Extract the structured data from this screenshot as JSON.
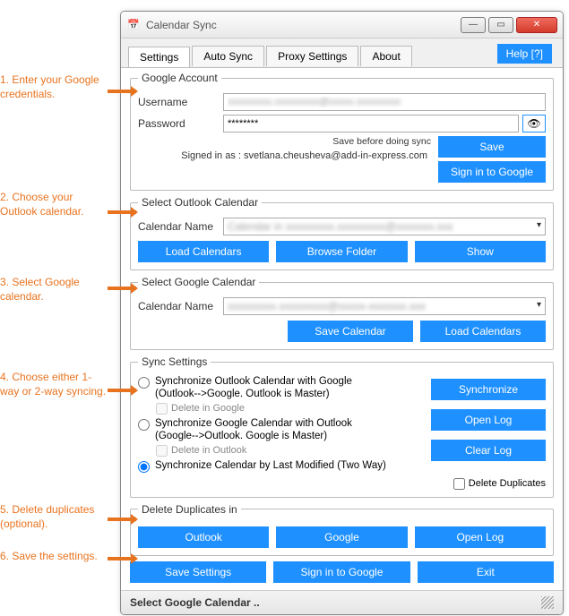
{
  "window": {
    "title": "Calendar Sync"
  },
  "tabs": {
    "settings": "Settings",
    "auto": "Auto Sync",
    "proxy": "Proxy Settings",
    "about": "About",
    "help": "Help [?]"
  },
  "annotations": {
    "a1": "1. Enter your Google credentials.",
    "a2": "2. Choose your Outlook calendar.",
    "a3": "3. Select Google calendar.",
    "a4": "4. Choose either 1-way or 2-way syncing.",
    "a5": "5. Delete duplicates (optional).",
    "a6": "6. Save the settings."
  },
  "google_account": {
    "legend": "Google Account",
    "username_label": "Username",
    "username_value": "xxxxxxxxx.xxxxxxxxx@xxxxx.xxxxxxxxx",
    "password_label": "Password",
    "password_value": "********",
    "save_note": "Save before doing sync",
    "signed_in_prefix": "Signed in as : ",
    "signed_in_email": "svetlana.cheusheva@add-in-express.com",
    "save_btn": "Save",
    "signin_btn": "Sign in to Google"
  },
  "outlook": {
    "legend": "Select Outlook Calendar",
    "name_label": "Calendar Name",
    "name_value": "Calendar in xxxxxxxxx.xxxxxxxxx@xxxxxxx.xxx",
    "load_btn": "Load Calendars",
    "browse_btn": "Browse Folder",
    "show_btn": "Show"
  },
  "gcal": {
    "legend": "Select Google Calendar",
    "name_label": "Calendar Name",
    "name_value": "xxxxxxxxx.xxxxxxxxx@xxxxx-xxxxxxx.xxx",
    "save_btn": "Save Calendar",
    "load_btn": "Load Calendars"
  },
  "sync": {
    "legend": "Sync Settings",
    "opt1a": "Synchronize Outlook Calendar with Google",
    "opt1b": "(Outlook-->Google. Outlook is Master)",
    "del1": "Delete in Google",
    "opt2a": "Synchronize Google Calendar with Outlook",
    "opt2b": "(Google-->Outlook. Google is Master)",
    "del2": "Delete in Outlook",
    "opt3": "Synchronize Calendar by Last Modified (Two Way)",
    "sync_btn": "Synchronize",
    "openlog_btn": "Open Log",
    "clearlog_btn": "Clear Log",
    "deldup_check": "Delete Duplicates"
  },
  "deldup": {
    "legend": "Delete Duplicates in",
    "outlook_btn": "Outlook",
    "google_btn": "Google",
    "openlog_btn": "Open Log"
  },
  "footer": {
    "save_btn": "Save Settings",
    "signin_btn": "Sign in to Google",
    "exit_btn": "Exit"
  },
  "status": {
    "text": "Select Google Calendar .."
  }
}
